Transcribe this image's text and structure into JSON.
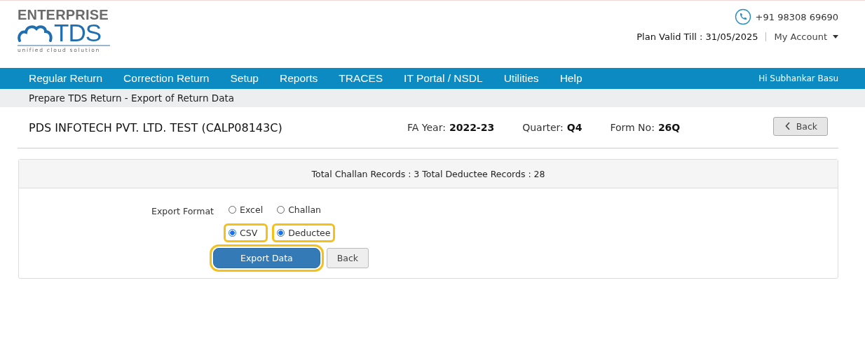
{
  "logo": {
    "brand": "ENTERPRISE",
    "product": "TDS",
    "tagline": "unified cloud solution"
  },
  "header": {
    "phone": "+91 98308 69690",
    "plan_valid": "Plan Valid Till : 31/05/2025",
    "account_menu": "My Account"
  },
  "nav": {
    "items": [
      "Regular Return",
      "Correction Return",
      "Setup",
      "Reports",
      "TRACES",
      "IT Portal / NSDL",
      "Utilities",
      "Help"
    ],
    "greeting": "Hi Subhankar Basu"
  },
  "breadcrumb": "Prepare TDS Return - Export of Return Data",
  "company": "PDS INFOTECH PVT. LTD. TEST (CALP08143C)",
  "meta": [
    {
      "label": "FA Year:",
      "value": "2022-23"
    },
    {
      "label": "Quarter:",
      "value": "Q4"
    },
    {
      "label": "Form No:",
      "value": "26Q"
    }
  ],
  "back_top": "Back",
  "summary": "Total Challan Records : 3 Total Deductee Records : 28",
  "export_format": {
    "label": "Export Format",
    "groups": [
      [
        {
          "label": "Excel",
          "selected": false,
          "highlighted": false
        },
        {
          "label": "CSV",
          "selected": true,
          "highlighted": true
        }
      ],
      [
        {
          "label": "Challan",
          "selected": false,
          "highlighted": false
        },
        {
          "label": "Deductee",
          "selected": true,
          "highlighted": true
        }
      ]
    ]
  },
  "buttons": [
    {
      "label": "Export Data",
      "kind": "primary",
      "highlighted": true
    },
    {
      "label": "Back",
      "kind": "default",
      "highlighted": false
    }
  ]
}
